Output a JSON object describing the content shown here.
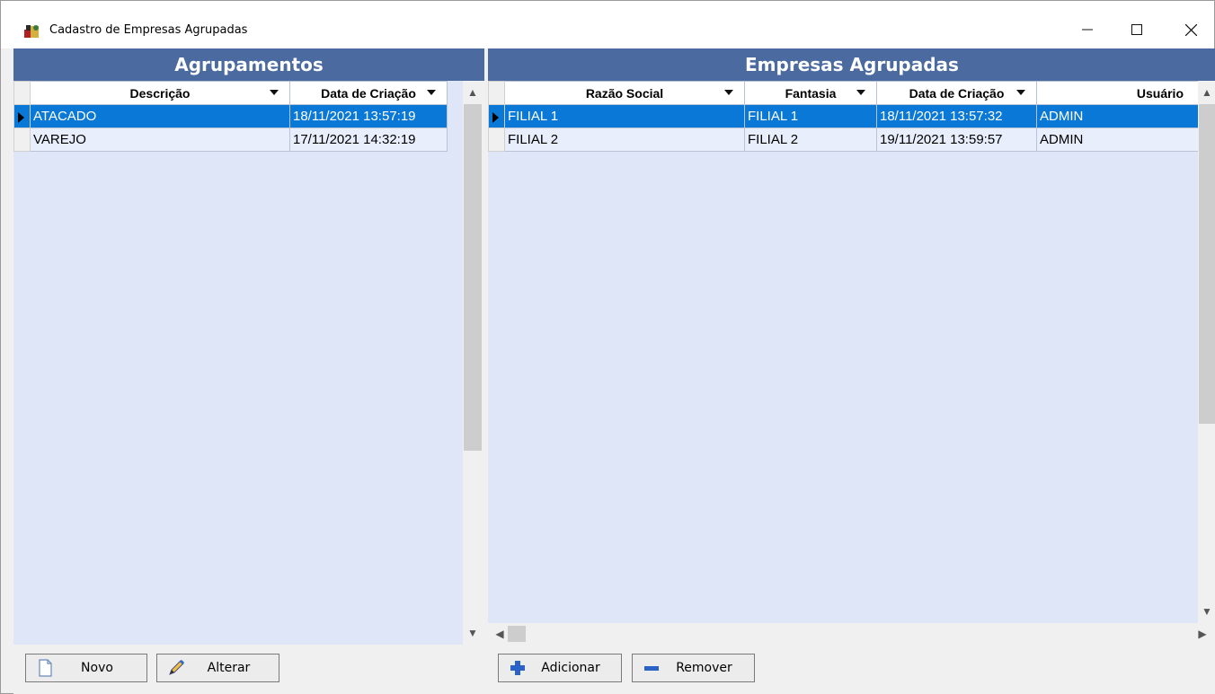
{
  "window": {
    "title": "Cadastro de Empresas Agrupadas",
    "minimize": "—",
    "maximize": "☐",
    "close": "✕"
  },
  "left_panel": {
    "header": "Agrupamentos",
    "columns": [
      "Descrição",
      "Data de Criação"
    ],
    "rows": [
      {
        "descricao": "ATACADO",
        "data": "18/11/2021 13:57:19",
        "selected": true
      },
      {
        "descricao": "VAREJO",
        "data": "17/11/2021 14:32:19",
        "selected": false
      }
    ]
  },
  "right_panel": {
    "header": "Empresas Agrupadas",
    "columns": [
      "Razão Social",
      "Fantasia",
      "Data de Criação",
      "Usuário"
    ],
    "rows": [
      {
        "razao": "FILIAL 1",
        "fantasia": "FILIAL 1",
        "data": "18/11/2021 13:57:32",
        "usuario": "ADMIN",
        "selected": true
      },
      {
        "razao": "FILIAL 2",
        "fantasia": "FILIAL 2",
        "data": "19/11/2021 13:59:57",
        "usuario": "ADMIN",
        "selected": false
      }
    ]
  },
  "buttons": {
    "novo": "Novo",
    "alterar": "Alterar",
    "adicionar": "Adicionar",
    "remover": "Remover"
  },
  "colors": {
    "header_bg": "#4a6aa0",
    "grid_bg": "#dfe6f8",
    "selection": "#0a78d6"
  }
}
